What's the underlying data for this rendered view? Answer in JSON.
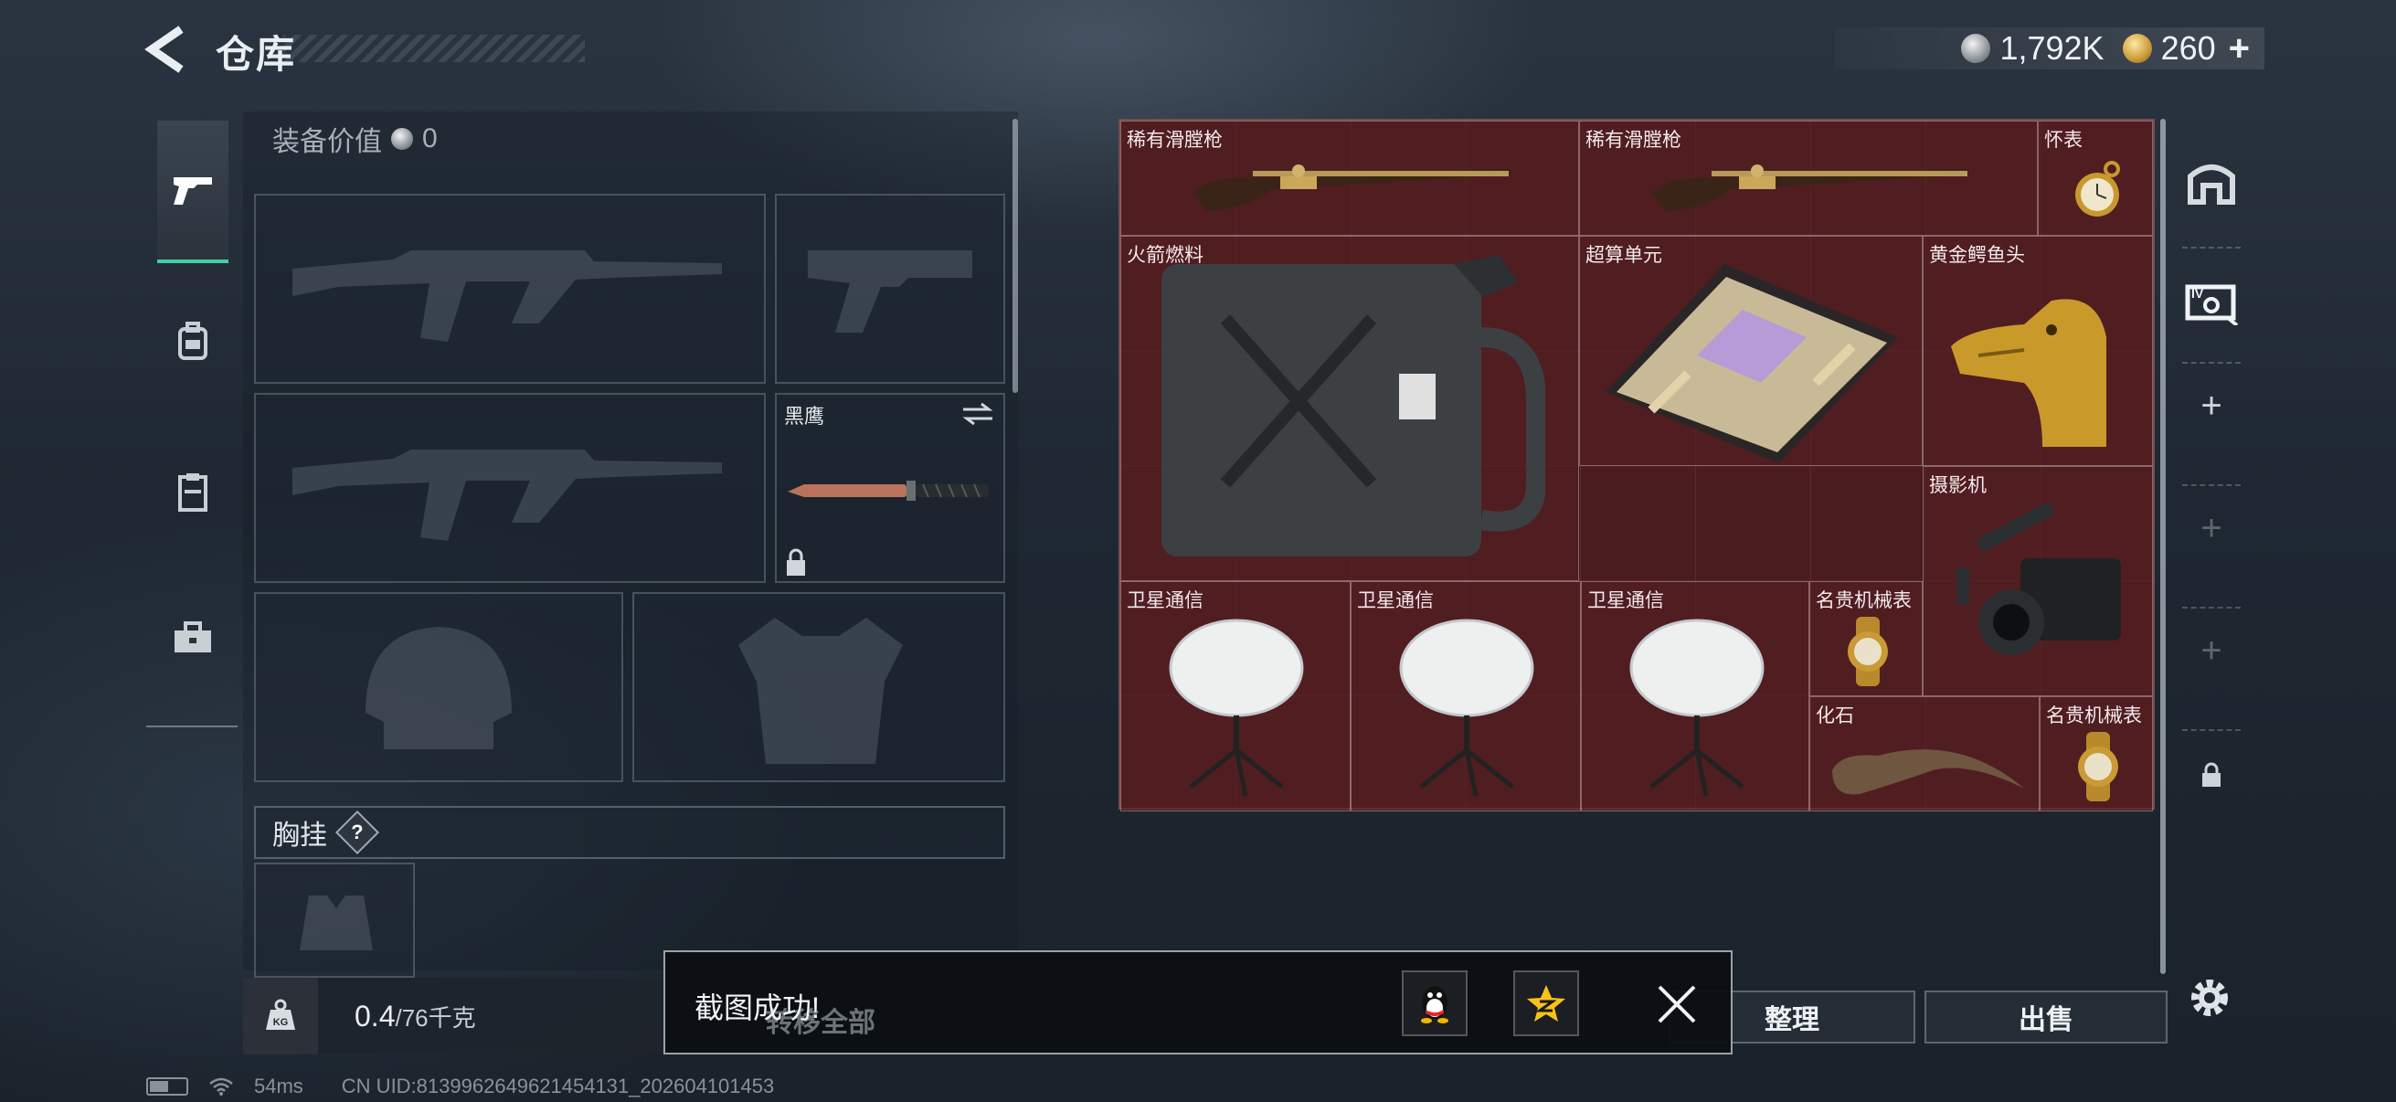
{
  "header": {
    "title": "仓库",
    "currencies": [
      {
        "icon": "silver-coin-icon",
        "value": "1,792K"
      },
      {
        "icon": "gold-coin-icon",
        "value": "260"
      }
    ],
    "add_symbol": "+"
  },
  "left_tabs": [
    {
      "icon": "pistol-icon",
      "active": true
    },
    {
      "icon": "backpack-icon",
      "active": false
    },
    {
      "icon": "clipboard-icon",
      "active": false
    },
    {
      "icon": "toolbox-icon",
      "active": false
    }
  ],
  "equipment": {
    "value_label": "装备价值",
    "value": "0",
    "melee_slot_name": "黑鹰",
    "chest_rig_label": "胸挂",
    "help_symbol": "?"
  },
  "weight": {
    "current": "0.4",
    "capacity": "/76千克",
    "icon_text": "KG"
  },
  "inventory": {
    "items": [
      {
        "label": "稀有滑膛枪",
        "kind": "musket"
      },
      {
        "label": "稀有滑膛枪",
        "kind": "musket"
      },
      {
        "label": "怀表",
        "kind": "pocket-watch"
      },
      {
        "label": "火箭燃料",
        "kind": "fuel-can"
      },
      {
        "label": "超算单元",
        "kind": "circuit-board"
      },
      {
        "label": "黄金鳄鱼头",
        "kind": "gold-croc-head"
      },
      {
        "label": "摄影机",
        "kind": "camera"
      },
      {
        "label": "卫星通信",
        "kind": "satellite-dish"
      },
      {
        "label": "卫星通信",
        "kind": "satellite-dish"
      },
      {
        "label": "卫星通信",
        "kind": "satellite-dish"
      },
      {
        "label": "名贵机械表",
        "kind": "wristwatch"
      },
      {
        "label": "化石",
        "kind": "fossil-claw"
      },
      {
        "label": "名贵机械表",
        "kind": "wristwatch"
      }
    ]
  },
  "buttons": {
    "transfer_all": "转移全部",
    "sort": "整理",
    "sell": "出售"
  },
  "toast": {
    "message": "截图成功!"
  },
  "status_bar": {
    "ping": "54ms",
    "uid": "CN UID:8139962649621454131_202604101453"
  },
  "colors": {
    "grid_bg": "#4a1c20",
    "accent": "#3fd1a6"
  }
}
